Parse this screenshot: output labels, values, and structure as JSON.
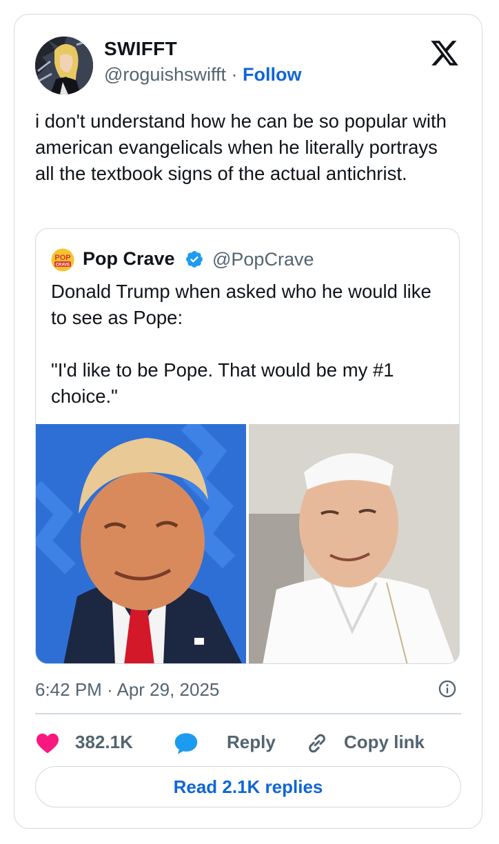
{
  "author": {
    "display_name": "SWIFFT",
    "handle": "@roguishswifft",
    "separator": "·",
    "follow_label": "Follow"
  },
  "tweet": {
    "text": "i don't understand how he can be so popular with american evangelicals when he literally portrays all the textbook signs of the actual antichrist."
  },
  "quoted_tweet": {
    "logo_text_top": "POP",
    "logo_text_bottom": "CRAVE",
    "display_name": "Pop Crave",
    "handle": "@PopCrave",
    "text": "Donald Trump when asked who he would like to see as Pope:\n\n\"I'd like to be Pope. That would be my #1 choice.\""
  },
  "timestamp": "6:42 PM · Apr 29, 2025",
  "actions": {
    "likes": "382.1K",
    "reply_label": "Reply",
    "copy_link_label": "Copy link"
  },
  "read_replies_label": "Read 2.1K replies",
  "colors": {
    "accent": "#0f66d8",
    "like": "#f91880",
    "reply_bubble": "#1d9bf0",
    "verified": "#1d9bf0",
    "muted": "#536471",
    "border": "#cfd9de"
  },
  "icons": [
    "x-logo-icon",
    "heart-icon",
    "reply-bubble-icon",
    "link-icon",
    "info-icon",
    "verified-badge-icon"
  ]
}
